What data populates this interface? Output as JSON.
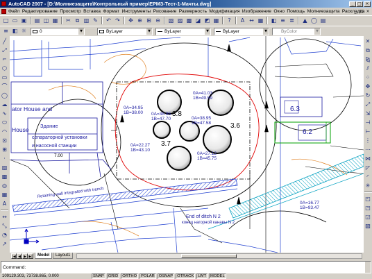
{
  "app": {
    "title": "AutoCAD 2007 - [D:\\Молниезащита\\Контрольный пример\\ЕРМЗ-Тест-1-Мачты.dwg]",
    "window_buttons": [
      "_",
      "□",
      "×"
    ],
    "doc_buttons": [
      "_",
      "□",
      "×"
    ]
  },
  "menu": {
    "items": [
      "Файл",
      "Редактирование",
      "Просмотр",
      "Вставка",
      "Формат",
      "Инструменты",
      "Рисование",
      "Размерность",
      "Модификация",
      "Изображение",
      "Окно",
      "Помощь",
      "Молниезащита",
      "Раскладка"
    ]
  },
  "toolbar_standard": {
    "icons": [
      "new-icon",
      "open-icon",
      "save-icon",
      "sep",
      "plot-icon",
      "plot-preview-icon",
      "publish-icon",
      "sep",
      "cut-icon",
      "copy-icon",
      "paste-icon",
      "match-properties-icon",
      "sep",
      "undo-icon",
      "redo-icon",
      "sep",
      "pan-icon",
      "zoom-realtime-icon",
      "zoom-window-icon",
      "zoom-previous-icon",
      "sep",
      "properties-icon",
      "design-center-icon",
      "tool-palettes-icon",
      "sheet-set-icon",
      "markup-icon",
      "calculator-icon",
      "sep",
      "help-icon",
      "sep",
      "text-style-icon",
      "dim-style-icon",
      "table-style-icon",
      "sep",
      "workspace-icon",
      "layer-states-icon",
      "layer-previous-icon",
      "sep",
      "lightning-mast-icon",
      "protection-zone-icon",
      "report-icon"
    ]
  },
  "properties_bar": {
    "layer_icons": [
      "layer-manager-icon",
      "layer-state-icon",
      "layer-freeze-icon"
    ],
    "layer": "0",
    "color": "ByLayer",
    "linetype": "ByLayer",
    "lineweight": "ByLayer",
    "plotstyle": "ByColor"
  },
  "draw_toolbar": {
    "icons": [
      "line-icon",
      "construction-line-icon",
      "polyline-icon",
      "polygon-icon",
      "rectangle-icon",
      "arc-icon",
      "circle-icon",
      "revision-cloud-icon",
      "spline-icon",
      "ellipse-icon",
      "ellipse-arc-icon",
      "insert-block-icon",
      "make-block-icon",
      "point-icon",
      "hatch-icon",
      "gradient-icon",
      "region-icon",
      "table-icon",
      "multiline-text-icon",
      "sep",
      "dimension-linear-icon",
      "dimension-aligned-icon",
      "dimension-radius-icon",
      "leader-icon"
    ]
  },
  "modify_toolbar": {
    "icons": [
      "erase-icon",
      "copy-object-icon",
      "mirror-icon",
      "offset-icon",
      "array-icon",
      "move-icon",
      "rotate-icon",
      "scale-icon",
      "stretch-icon",
      "trim-icon",
      "extend-icon",
      "break-at-point-icon",
      "break-icon",
      "join-icon",
      "chamfer-icon",
      "fillet-icon",
      "explode-icon",
      "sep",
      "draw-order-icon",
      "bring-front-icon",
      "send-back-icon",
      "hatch-edit-icon"
    ]
  },
  "drawing": {
    "labels": [
      "ator House and",
      "House",
      "Здание",
      "сепараторной установки",
      "и насосной станции",
      "3.8",
      "3.6",
      "3.7",
      "6.3",
      "6.2",
      "0A=41.03",
      "1B=49.59",
      "0A=38.95",
      "1B=47.70",
      "0A=38.95",
      "1B=47.58",
      "0A=34.95",
      "1B=38.00",
      "0A=22.27",
      "1B=43.10",
      "0A=27.12",
      "1B=45.75",
      "End of ditch N 2",
      "конец нагорной канавы N 2",
      "Retaining wall integrated with trench",
      "0A=16.77",
      "1B=93.47",
      "7.00"
    ]
  },
  "tabs": {
    "items": [
      "Model",
      "Layout1"
    ],
    "active": "Model"
  },
  "command": {
    "prompt": "Command:"
  },
  "status": {
    "coordinates": "109129.303, 73738.865, 0.000",
    "toggles": [
      "SNAP",
      "GRID",
      "ORTHO",
      "POLAR",
      "OSNAP",
      "OTRACK",
      "LWT",
      "MODEL"
    ]
  },
  "colors": {
    "title_start": "#0a246a",
    "title_end": "#a6caf0",
    "chrome": "#d4d0c8",
    "canvas": "#ffffff",
    "labels_blue": "#1a1aa0",
    "contour_red": "#e00000",
    "hatch_cyan": "#00a0c0"
  }
}
